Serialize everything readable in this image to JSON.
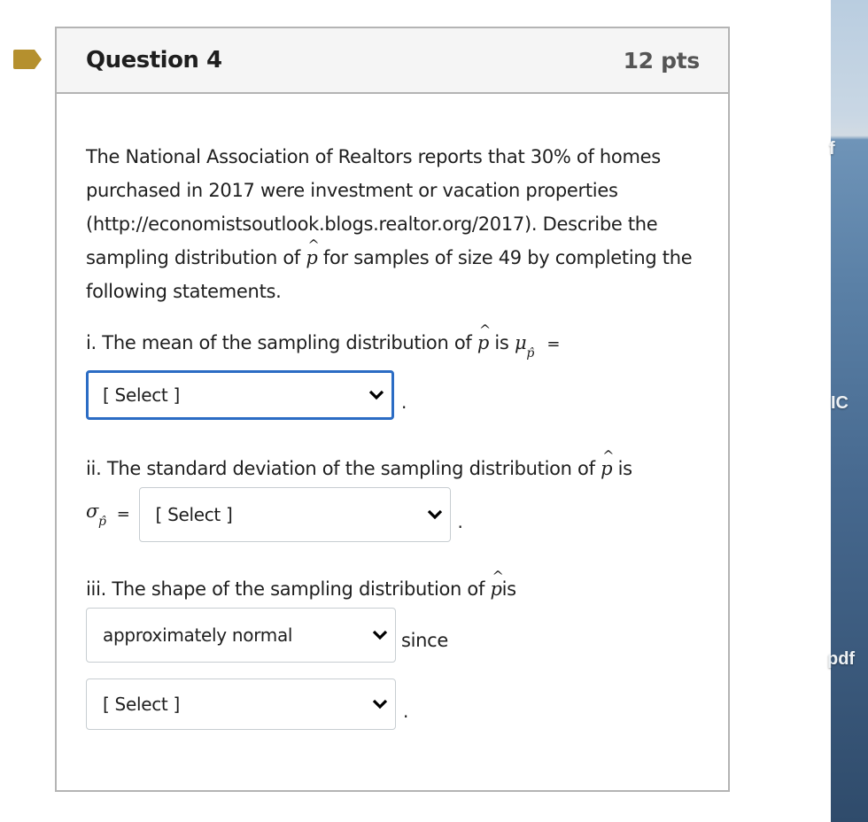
{
  "question": {
    "title": "Question 4",
    "points": "12 pts",
    "flag_color": "#b5902e",
    "intro_part1": "The National Association of Realtors reports that 30% of homes purchased in 2017 were investment or vacation properties (http://economistsoutlook.blogs.realtor.org/2017). Describe the sampling distribution of ",
    "intro_part2": " for samples of size 49 by completing the following statements.",
    "p_symbol": "p",
    "hat_symbol": "^",
    "statements": {
      "i": {
        "text": "i. The mean of the sampling distribution of ",
        "text_is": " is ",
        "mu_symbol": "μ",
        "equals": "=",
        "select_value": "[ Select ]",
        "suffix": "."
      },
      "ii": {
        "text": "ii. The standard deviation of the sampling distribution of ",
        "text_is": " is",
        "sigma_symbol": "σ",
        "equals": "=",
        "select_value": "[ Select ]",
        "suffix": "."
      },
      "iii": {
        "text": "iii. The shape of the sampling distribution of ",
        "text_is": "is",
        "select_shape_value": "approximately normal",
        "since": "since",
        "select_reason_value": "[ Select ]",
        "suffix": "."
      }
    }
  },
  "desktop": {
    "labels": [
      "f",
      "IC",
      "pdf"
    ]
  }
}
